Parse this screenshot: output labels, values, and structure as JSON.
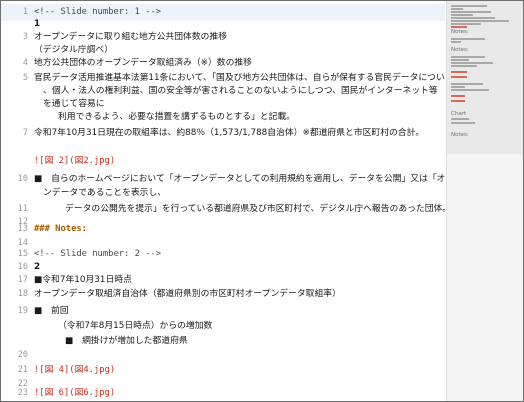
{
  "editor": {
    "lines": [
      {
        "num": "1",
        "text": "<!-- Slide number: 1 -->"
      },
      {
        "num": "",
        "text": "1"
      },
      {
        "num": "3",
        "text": "オープンデータに取り組む地方公共団体数の推移"
      },
      {
        "num": "",
        "text": "（デジタル庁調べ）"
      },
      {
        "num": "4",
        "text": "地方公共団体のオープンデータ取組済み（※）数の推移"
      },
      {
        "num": "5",
        "text": "官民データ活用推進基本法第11条において、「国及び地方公共団体は、自らが保有する官民データについて"
      },
      {
        "num": "",
        "text": "、個人・法人の権利利益、国の安全等が害されることのないようにしつつ、国民がインターネット等"
      },
      {
        "num": "",
        "text": "を通じて容易に"
      },
      {
        "num": "",
        "text": "利用できるよう、必要な措置を講ずるものとする」と記載。"
      },
      {
        "num": "7",
        "text": "令和7年10月31日現在の取組率は、約88％（1,573/1,788自治体）※都道府県と市区町村の合計。"
      },
      {
        "num": "",
        "text": "![図 2](図2.jpg)"
      },
      {
        "num": "10",
        "text": "■　自らのホームページにおいて「オープンデータとしての利用規約を適用し、データを公開」又は「オープ"
      },
      {
        "num": "",
        "text": "ンデータであることを表示し、"
      },
      {
        "num": "11",
        "text": "データの公開先を提示」を行っている都道府県及び市区町村で、デジタル庁へ報告のあった団体。"
      },
      {
        "num": "12",
        "text": ""
      },
      {
        "num": "13",
        "text": "### Notes:"
      },
      {
        "num": "14",
        "text": ""
      },
      {
        "num": "15",
        "text": "<!-- Slide number: 2 -->"
      },
      {
        "num": "16",
        "text": "2"
      },
      {
        "num": "17",
        "text": "■令和7年10月31日時点"
      },
      {
        "num": "18",
        "text": "オープンデータ取組済自治体（都道府県別の市区町村オープンデータ取組率）"
      },
      {
        "num": "19",
        "text": "■　前回"
      },
      {
        "num": "",
        "text": "（令和7年8月15日時点）からの増加数"
      },
      {
        "num": "",
        "text": "■　網掛けが増加した都道府県"
      },
      {
        "num": "20",
        "text": ""
      },
      {
        "num": "21",
        "text": "![図 4](図4.jpg)"
      },
      {
        "num": "22",
        "text": ""
      },
      {
        "num": "23",
        "text": "![図 6](図6.jpg)"
      }
    ]
  },
  "minimap": {
    "labels": [
      "Notes:",
      "Notes:",
      "Chart",
      "Notes:"
    ]
  },
  "colors": {
    "image_link": "#c72d1c",
    "heading": "#a65e00",
    "active_line": "#eef2fb"
  }
}
